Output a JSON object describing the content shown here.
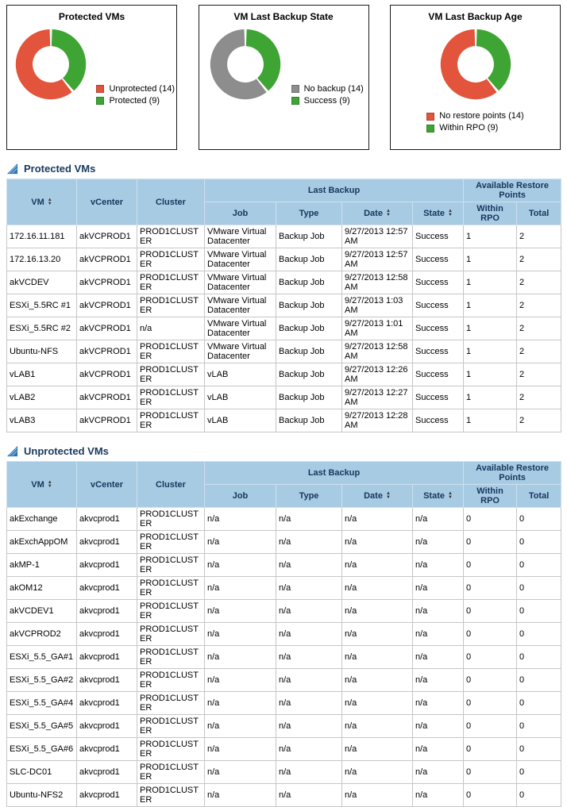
{
  "chart_data": [
    {
      "type": "pie",
      "subtype": "donut",
      "title": "Protected VMs",
      "labels": [
        "Unprotected",
        "Protected"
      ],
      "values": [
        14,
        9
      ],
      "total": 23,
      "colors": [
        "#E2543B",
        "#3EA434"
      ],
      "legend": [
        "Unprotected (14)",
        "Protected (9)"
      ],
      "legend_position": "bottom",
      "start_deg": 51
    },
    {
      "type": "pie",
      "subtype": "donut",
      "title": "VM Last Backup State",
      "labels": [
        "No backup",
        "Success"
      ],
      "values": [
        14,
        9
      ],
      "total": 23,
      "colors": [
        "#8D8D8D",
        "#3EA434"
      ],
      "legend": [
        "No backup (14)",
        "Success (9)"
      ],
      "legend_position": "bottom",
      "start_deg": 51
    },
    {
      "type": "pie",
      "subtype": "donut",
      "title": "VM Last Backup Age",
      "labels": [
        "No restore points",
        "Within RPO"
      ],
      "values": [
        14,
        9
      ],
      "total": 23,
      "colors": [
        "#E2543B",
        "#3EA434"
      ],
      "legend": [
        "No restore points (14)",
        "Within RPO (9)"
      ],
      "legend_position": "bottom",
      "start_deg": 51
    }
  ],
  "icons": {
    "sort_up": "▲",
    "sort_down": "▼"
  },
  "headers": {
    "vm": "VM",
    "vcenter": "vCenter",
    "cluster": "Cluster",
    "last_backup": "Last Backup",
    "job": "Job",
    "type": "Type",
    "date": "Date",
    "state": "State",
    "available_restore_points": "Available Restore Points",
    "within_rpo": "Within RPO",
    "total": "Total"
  },
  "sections": {
    "protected": {
      "title": "Protected VMs",
      "rows": [
        [
          "172.16.11.181",
          "akVCPROD1",
          "PROD1CLUSTER",
          "VMware Virtual Datacenter",
          "Backup Job",
          "9/27/2013 12:57 AM",
          "Success",
          "1",
          "2"
        ],
        [
          "172.16.13.20",
          "akVCPROD1",
          "PROD1CLUSTER",
          "VMware Virtual Datacenter",
          "Backup Job",
          "9/27/2013 12:57 AM",
          "Success",
          "1",
          "2"
        ],
        [
          "akVCDEV",
          "akVCPROD1",
          "PROD1CLUSTER",
          "VMware Virtual Datacenter",
          "Backup Job",
          "9/27/2013 12:58 AM",
          "Success",
          "1",
          "2"
        ],
        [
          "ESXi_5.5RC #1",
          "akVCPROD1",
          "PROD1CLUSTER",
          "VMware Virtual Datacenter",
          "Backup Job",
          "9/27/2013 1:03 AM",
          "Success",
          "1",
          "2"
        ],
        [
          "ESXi_5.5RC #2",
          "akVCPROD1",
          "n/a",
          "VMware Virtual Datacenter",
          "Backup Job",
          "9/27/2013 1:01 AM",
          "Success",
          "1",
          "2"
        ],
        [
          "Ubuntu-NFS",
          "akVCPROD1",
          "PROD1CLUSTER",
          "VMware Virtual Datacenter",
          "Backup Job",
          "9/27/2013 12:58 AM",
          "Success",
          "1",
          "2"
        ],
        [
          "vLAB1",
          "akVCPROD1",
          "PROD1CLUSTER",
          "vLAB",
          "Backup Job",
          "9/27/2013 12:26 AM",
          "Success",
          "1",
          "2"
        ],
        [
          "vLAB2",
          "akVCPROD1",
          "PROD1CLUSTER",
          "vLAB",
          "Backup Job",
          "9/27/2013 12:27 AM",
          "Success",
          "1",
          "2"
        ],
        [
          "vLAB3",
          "akVCPROD1",
          "PROD1CLUSTER",
          "vLAB",
          "Backup Job",
          "9/27/2013 12:28 AM",
          "Success",
          "1",
          "2"
        ]
      ]
    },
    "unprotected": {
      "title": "Unprotected VMs",
      "rows": [
        [
          "akExchange",
          "akvcprod1",
          "PROD1CLUSTER",
          "n/a",
          "n/a",
          "n/a",
          "n/a",
          "0",
          "0"
        ],
        [
          "akExchAppOM",
          "akvcprod1",
          "PROD1CLUSTER",
          "n/a",
          "n/a",
          "n/a",
          "n/a",
          "0",
          "0"
        ],
        [
          "akMP-1",
          "akvcprod1",
          "PROD1CLUSTER",
          "n/a",
          "n/a",
          "n/a",
          "n/a",
          "0",
          "0"
        ],
        [
          "akOM12",
          "akvcprod1",
          "PROD1CLUSTER",
          "n/a",
          "n/a",
          "n/a",
          "n/a",
          "0",
          "0"
        ],
        [
          "akVCDEV1",
          "akvcprod1",
          "PROD1CLUSTER",
          "n/a",
          "n/a",
          "n/a",
          "n/a",
          "0",
          "0"
        ],
        [
          "akVCPROD2",
          "akvcprod1",
          "PROD1CLUSTER",
          "n/a",
          "n/a",
          "n/a",
          "n/a",
          "0",
          "0"
        ],
        [
          "ESXi_5.5_GA#1",
          "akvcprod1",
          "PROD1CLUSTER",
          "n/a",
          "n/a",
          "n/a",
          "n/a",
          "0",
          "0"
        ],
        [
          "ESXi_5.5_GA#2",
          "akvcprod1",
          "PROD1CLUSTER",
          "n/a",
          "n/a",
          "n/a",
          "n/a",
          "0",
          "0"
        ],
        [
          "ESXi_5.5_GA#4",
          "akvcprod1",
          "PROD1CLUSTER",
          "n/a",
          "n/a",
          "n/a",
          "n/a",
          "0",
          "0"
        ],
        [
          "ESXi_5.5_GA#5",
          "akvcprod1",
          "PROD1CLUSTER",
          "n/a",
          "n/a",
          "n/a",
          "n/a",
          "0",
          "0"
        ],
        [
          "ESXi_5.5_GA#6",
          "akvcprod1",
          "PROD1CLUSTER",
          "n/a",
          "n/a",
          "n/a",
          "n/a",
          "0",
          "0"
        ],
        [
          "SLC-DC01",
          "akvcprod1",
          "PROD1CLUSTER",
          "n/a",
          "n/a",
          "n/a",
          "n/a",
          "0",
          "0"
        ],
        [
          "Ubuntu-NFS2",
          "akvcprod1",
          "PROD1CLUSTER",
          "n/a",
          "n/a",
          "n/a",
          "n/a",
          "0",
          "0"
        ]
      ]
    }
  }
}
